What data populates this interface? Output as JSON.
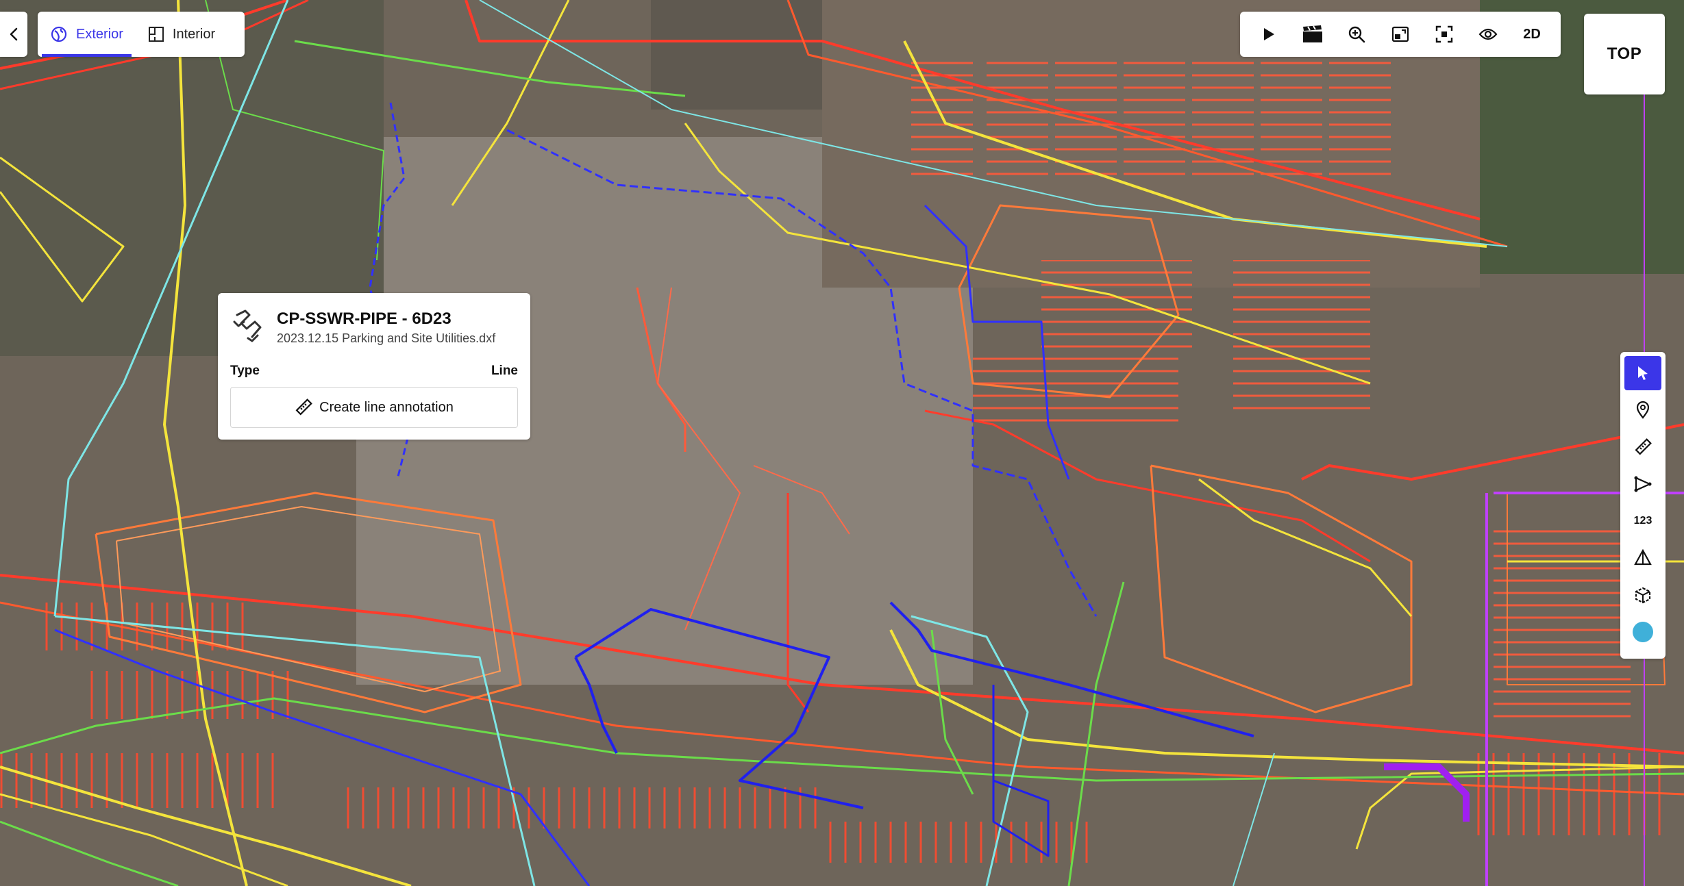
{
  "nav": {
    "back_icon": "chevron-left-icon",
    "tabs": [
      {
        "label": "Exterior",
        "icon": "globe-icon",
        "active": true
      },
      {
        "label": "Interior",
        "icon": "floorplan-icon",
        "active": false
      }
    ]
  },
  "toolbar": {
    "buttons": [
      {
        "icon": "play-icon"
      },
      {
        "icon": "clapperboard-icon"
      },
      {
        "icon": "zoom-in-icon"
      },
      {
        "icon": "minimap-icon"
      },
      {
        "icon": "fit-view-icon"
      },
      {
        "icon": "eye-icon"
      }
    ],
    "mode_label": "2D"
  },
  "view_cube": {
    "label": "TOP"
  },
  "right_tools": {
    "tools": [
      {
        "icon": "cursor-icon",
        "active": true
      },
      {
        "icon": "pin-icon"
      },
      {
        "icon": "ruler-icon"
      },
      {
        "icon": "polyline-icon"
      },
      {
        "icon": "numbering-icon",
        "label": "123"
      },
      {
        "icon": "pyramid-icon"
      },
      {
        "icon": "cube-3d-icon"
      },
      {
        "icon": "color-swatch-icon"
      }
    ],
    "swatch_color": "#3fb0d9"
  },
  "popup": {
    "icon": "pipe-layer-icon",
    "title": "CP-SSWR-PIPE - 6D23",
    "subtitle": "2023.12.15 Parking and Site Utilities.dxf",
    "type_label": "Type",
    "type_value": "Line",
    "action_label": "Create line annotation"
  },
  "colors": {
    "accent": "#3b36e8",
    "map_ground": "#6f6558",
    "cad_red": "#ff3b2b",
    "cad_orange": "#ff7a3a",
    "cad_yellow": "#f4e43c",
    "cad_green": "#6bdc4a",
    "cad_cyan": "#7ee6e6",
    "cad_blue": "#1a1ae0",
    "cad_purple": "#a020f0"
  }
}
